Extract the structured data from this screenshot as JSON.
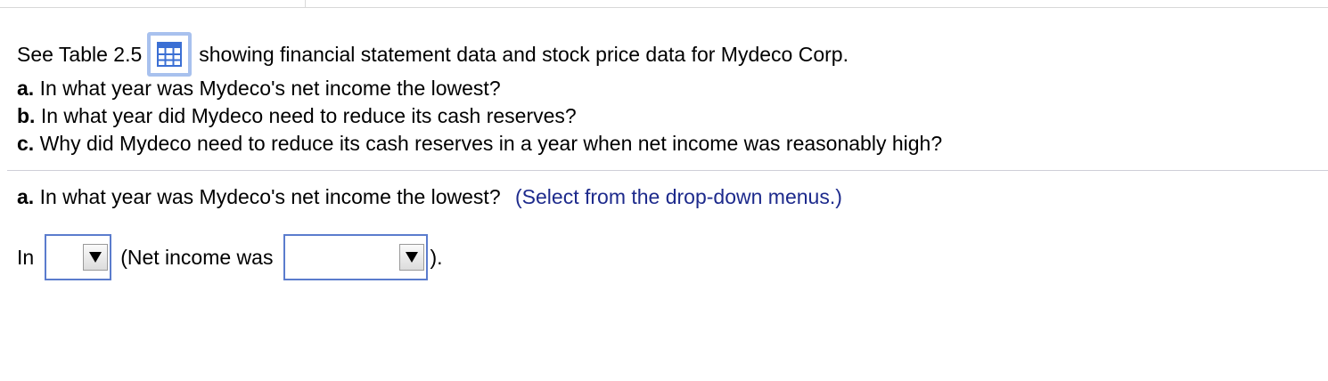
{
  "intro": {
    "prefix": "See Table 2.5",
    "icon": "table-grid-icon",
    "suffix": "showing financial statement data and stock price data for Mydeco Corp."
  },
  "questions": [
    {
      "letter": "a.",
      "text": "In what year was Mydeco's net income the lowest?"
    },
    {
      "letter": "b.",
      "text": "In what year did Mydeco need to reduce its cash reserves?"
    },
    {
      "letter": "c.",
      "text": "Why did Mydeco need to reduce its cash reserves in a year when net income was reasonably high?"
    }
  ],
  "part_a": {
    "letter": "a.",
    "question": "In what year was Mydeco's net income the lowest?",
    "instruction": "(Select from the drop-down menus.)"
  },
  "answer": {
    "prefix": "In",
    "middle": "(Net income was",
    "suffix": ").",
    "year_dropdown": {
      "selected": ""
    },
    "income_dropdown": {
      "selected": ""
    }
  },
  "colors": {
    "instruction": "#1d2a8c",
    "dropdown_border": "#5b7ccd",
    "icon_border": "#a8c1ee",
    "icon_grid": "#3b6fd4"
  }
}
